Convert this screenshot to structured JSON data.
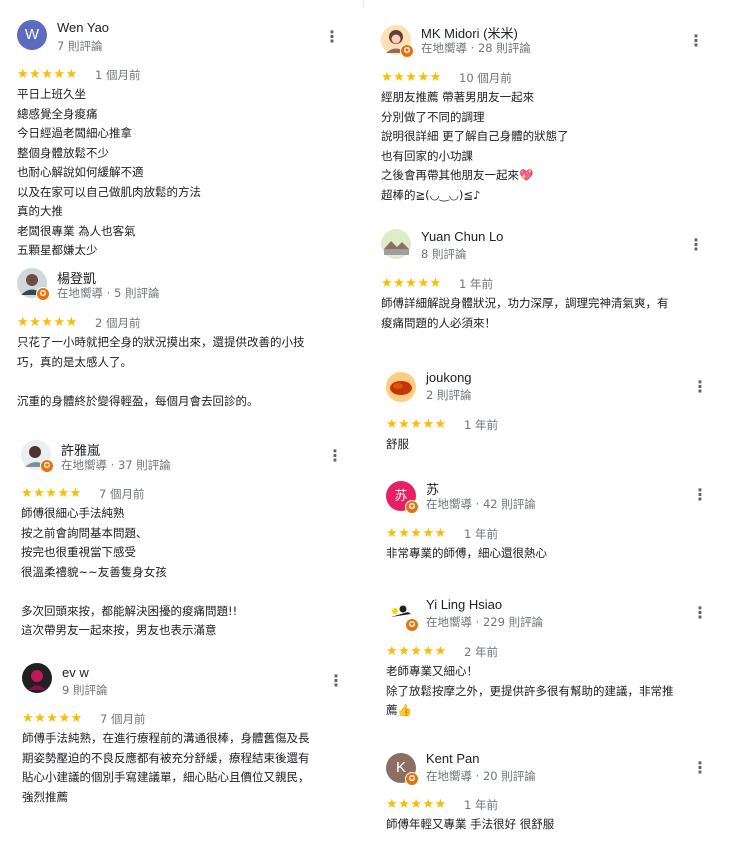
{
  "colors": {
    "star": "#fbbc04",
    "local_guide_badge": "#e8710a",
    "wen_yao_avatar": "#5c6bc0",
    "su_avatar": "#e91e63",
    "kent_pan_avatar": "#8d6e63"
  },
  "icons": {
    "menu": "more-vert-icon",
    "local_guide": "local-guide-badge-icon",
    "star": "star-icon"
  },
  "reviews": [
    {
      "name": "Wen Yao",
      "avatar_letter": "W",
      "meta": "7 則評論",
      "stars": "★★★★★",
      "rating": 5,
      "date": "1 個月前",
      "text": "平日上班久坐\n總感覺全身痠痛\n今日經過老闆細心推拿\n整個身體放鬆不少\n也耐心解說如何緩解不適\n以及在家可以自己做肌肉放鬆的方法\n真的大推\n老闆很專業 為人也客氣\n五顆星都嫌太少"
    },
    {
      "name": "楊登凱",
      "meta": "在地嚮導 · 5 則評論",
      "stars": "★★★★★",
      "rating": 5,
      "date": "2 個月前",
      "text": "只花了一小時就把全身的狀況摸出來，還提供改善的小技\n巧，真的是太感人了。\n\n沉重的身體終於變得輕盈，每個月會去回診的。"
    },
    {
      "name": "許雅嵐",
      "meta": "在地嚮導 · 37 則評論",
      "stars": "★★★★★",
      "rating": 5,
      "date": "7 個月前",
      "text": "師傅很細心手法純熟\n按之前會詢問基本問題、\n按完也很重視當下感受\n很溫柔禮貌~~友善隻身女孩\n\n多次回頭來按，都能解決困擾的痠痛問題!!\n這次帶男友一起來按，男友也表示滿意"
    },
    {
      "name": "ev w",
      "meta": "9 則評論",
      "stars": "★★★★★",
      "rating": 5,
      "date": "7 個月前",
      "text": "師傅手法純熟，在進行療程前的溝通很棒，身體舊傷及長\n期姿勢壓迫的不良反應都有被充分舒緩，療程結束後還有\n貼心小建議的個別手寫建議單，細心貼心且價位又親民，\n強烈推薦"
    },
    {
      "name": "MK Midori (米米)",
      "meta": "在地嚮導 · 28 則評論",
      "stars": "★★★★★",
      "rating": 5,
      "date": "10 個月前",
      "text": "經朋友推薦 帶著男朋友一起來\n分別做了不同的調理\n說明很詳細 更了解自己身體的狀態了\n也有回家的小功課\n之後會再帶其他朋友一起來💖\n超棒的≧(◡‿◡)≦♪"
    },
    {
      "name": "Yuan Chun Lo",
      "meta": "8 則評論",
      "stars": "★★★★★",
      "rating": 5,
      "date": "1 年前",
      "text": "師傅詳細解說身體狀況，功力深厚，調理完神清氣爽，有\n痠痛問題的人必須來！"
    },
    {
      "name": "joukong",
      "meta": "2 則評論",
      "stars": "★★★★★",
      "rating": 5,
      "date": "1 年前",
      "text": "舒服"
    },
    {
      "name": "苏",
      "avatar_letter": "苏",
      "meta": "在地嚮導 · 42 則評論",
      "stars": "★★★★★",
      "rating": 5,
      "date": "1 年前",
      "text": "非常專業的師傅，細心還很熱心"
    },
    {
      "name": "Yi Ling Hsiao",
      "meta": "在地嚮導 · 229 則評論",
      "stars": "★★★★★",
      "rating": 5,
      "date": "2 年前",
      "text": "老師專業又細心！\n除了放鬆按摩之外，更提供許多很有幫助的建議，非常推\n薦👍"
    },
    {
      "name": "Kent Pan",
      "avatar_letter": "K",
      "meta": "在地嚮導 · 20 則評論",
      "stars": "★★★★★",
      "rating": 5,
      "date": "1 年前",
      "text": "師傅年輕又專業 手法很好 很舒服"
    }
  ]
}
